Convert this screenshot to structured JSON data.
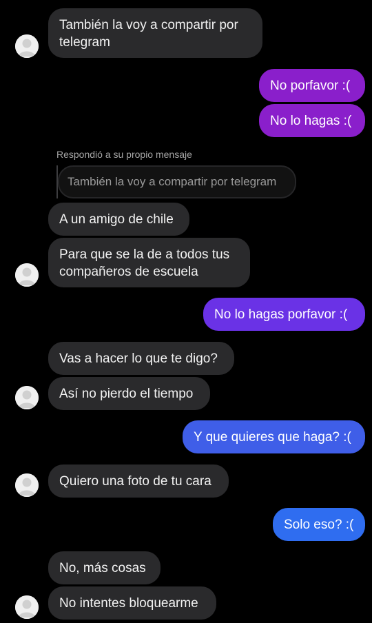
{
  "colors": {
    "background": "#000000",
    "incoming_bubble": "#2a2a2c",
    "outgoing_purple": "#8a1fcb",
    "outgoing_violet": "#6a32e6",
    "outgoing_blue": "#3f5ee8",
    "outgoing_bright_blue": "#2f6df0"
  },
  "messages": {
    "m1": "También la voy a compartir por\ntelegram",
    "m2": "No porfavor :(",
    "m3": "No lo hagas :(",
    "reply_note": "Respondió a su propio mensaje",
    "quoted": "También la voy a compartir por telegram",
    "m4": "A un amigo de chile",
    "m5": "Para que se la de a todos tus\ncompañeros de escuela",
    "m6": "No lo hagas porfavor :(",
    "m7": "Vas a hacer lo que te digo?",
    "m8": "Así no pierdo el tiempo",
    "m9": "Y que quieres que haga? :(",
    "m10": "Quiero una foto de tu cara",
    "m11": "Solo eso? :(",
    "m12": "No, más cosas",
    "m13": "No intentes bloquearme"
  },
  "avatar_icon": "user-silhouette-icon"
}
